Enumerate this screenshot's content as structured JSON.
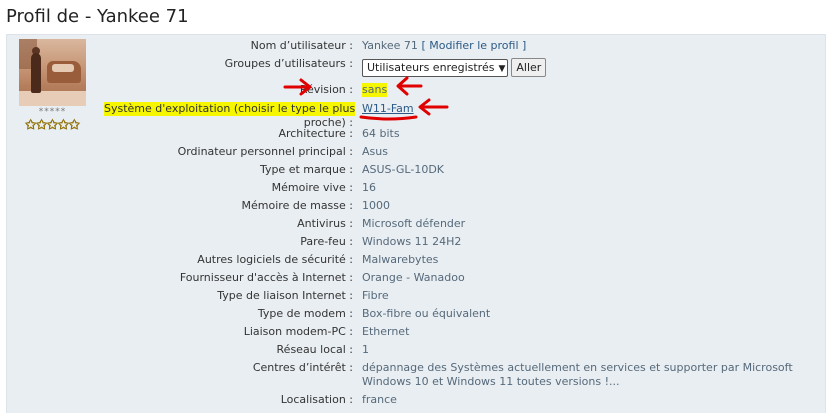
{
  "page": {
    "title": "Profil de - Yankee 71"
  },
  "avatar": {
    "rank_text": "*****",
    "rank_stars": "✩✩✩✩✩"
  },
  "profile": {
    "username_label": "Nom d’utilisateur :",
    "username_value": "Yankee 71",
    "modify_link": "[ Modifier le profil ]",
    "groups_label": "Groupes d’utilisateurs :",
    "groups_select": "Utilisateurs enregistrés",
    "go_button": "Aller",
    "revision_label": "Révision :",
    "revision_value": "sans",
    "os_label_line1": "Système d'exploitation (choisir le type le plus",
    "os_label_line2": "proche) :",
    "os_value": "W11-Fam",
    "arch_label": "Architecture :",
    "arch_value": "64 bits",
    "pc_label": "Ordinateur personnel principal :",
    "pc_value": "Asus",
    "brand_label": "Type et marque :",
    "brand_value": "ASUS-GL-10DK",
    "ram_label": "Mémoire vive :",
    "ram_value": "16",
    "storage_label": "Mémoire de masse :",
    "storage_value": "1000",
    "antivirus_label": "Antivirus :",
    "antivirus_value": "Microsoft défender",
    "firewall_label": "Pare-feu :",
    "firewall_value": "Windows 11 24H2",
    "security_label": "Autres logiciels de sécurité :",
    "security_value": "Malwarebytes",
    "isp_label": "Fournisseur d'accès à Internet :",
    "isp_value": "Orange - Wanadoo",
    "connection_label": "Type de liaison Internet :",
    "connection_value": "Fibre",
    "modem_label": "Type de modem :",
    "modem_value": "Box-fibre ou équivalent",
    "modem_pc_label": "Liaison modem-PC :",
    "modem_pc_value": "Ethernet",
    "lan_label": "Réseau local :",
    "lan_value": "1",
    "interests_label": "Centres d’intérêt :",
    "interests_line1": "dépannage des Systèmes actuellement en services et supporter par Microsoft",
    "interests_line2": "Windows 10 et Windows 11 toutes versions !...",
    "location_label": "Localisation :",
    "location_value": "france"
  },
  "colors": {
    "highlight": "#f6f600",
    "annotation": "#e00000",
    "panel": "#e9eef2"
  },
  "icons": {
    "arrow": "red-arrow-icon",
    "underline": "red-underline"
  }
}
